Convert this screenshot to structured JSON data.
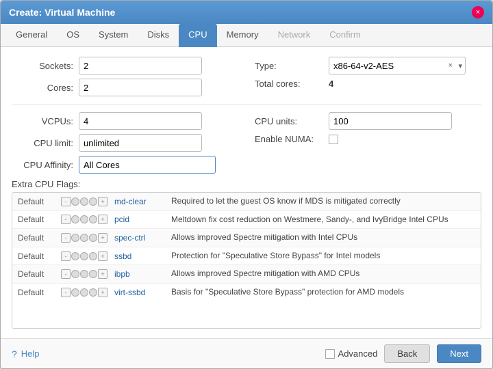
{
  "dialog": {
    "title": "Create: Virtual Machine",
    "close_label": "×"
  },
  "tabs": [
    {
      "id": "general",
      "label": "General",
      "state": "normal"
    },
    {
      "id": "os",
      "label": "OS",
      "state": "normal"
    },
    {
      "id": "system",
      "label": "System",
      "state": "normal"
    },
    {
      "id": "disks",
      "label": "Disks",
      "state": "normal"
    },
    {
      "id": "cpu",
      "label": "CPU",
      "state": "active"
    },
    {
      "id": "memory",
      "label": "Memory",
      "state": "normal"
    },
    {
      "id": "network",
      "label": "Network",
      "state": "disabled"
    },
    {
      "id": "confirm",
      "label": "Confirm",
      "state": "disabled"
    }
  ],
  "form": {
    "sockets_label": "Sockets:",
    "sockets_value": "2",
    "cores_label": "Cores:",
    "cores_value": "2",
    "vcpus_label": "VCPUs:",
    "vcpus_value": "4",
    "cpu_limit_label": "CPU limit:",
    "cpu_limit_value": "unlimited",
    "cpu_affinity_label": "CPU Affinity:",
    "cpu_affinity_value": "All Cores",
    "type_label": "Type:",
    "type_value": "x86-64-v2-AES",
    "total_cores_label": "Total cores:",
    "total_cores_value": "4",
    "cpu_units_label": "CPU units:",
    "cpu_units_value": "100",
    "enable_numa_label": "Enable NUMA:",
    "extra_flags_label": "Extra CPU Flags:"
  },
  "flags": [
    {
      "default": "Default",
      "name": "md-clear",
      "desc": "Required to let the guest OS know if MDS is mitigated correctly"
    },
    {
      "default": "Default",
      "name": "pcid",
      "desc": "Meltdown fix cost reduction on Westmere, Sandy-, and IvyBridge Intel CPUs"
    },
    {
      "default": "Default",
      "name": "spec-ctrl",
      "desc": "Allows improved Spectre mitigation with Intel CPUs"
    },
    {
      "default": "Default",
      "name": "ssbd",
      "desc": "Protection for \"Speculative Store Bypass\" for Intel models"
    },
    {
      "default": "Default",
      "name": "ibpb",
      "desc": "Allows improved Spectre mitigation with AMD CPUs"
    },
    {
      "default": "Default",
      "name": "virt-ssbd",
      "desc": "Basis for \"Speculative Store Bypass\" protection for AMD models"
    }
  ],
  "footer": {
    "help_label": "Help",
    "advanced_label": "Advanced",
    "back_label": "Back",
    "next_label": "Next"
  }
}
